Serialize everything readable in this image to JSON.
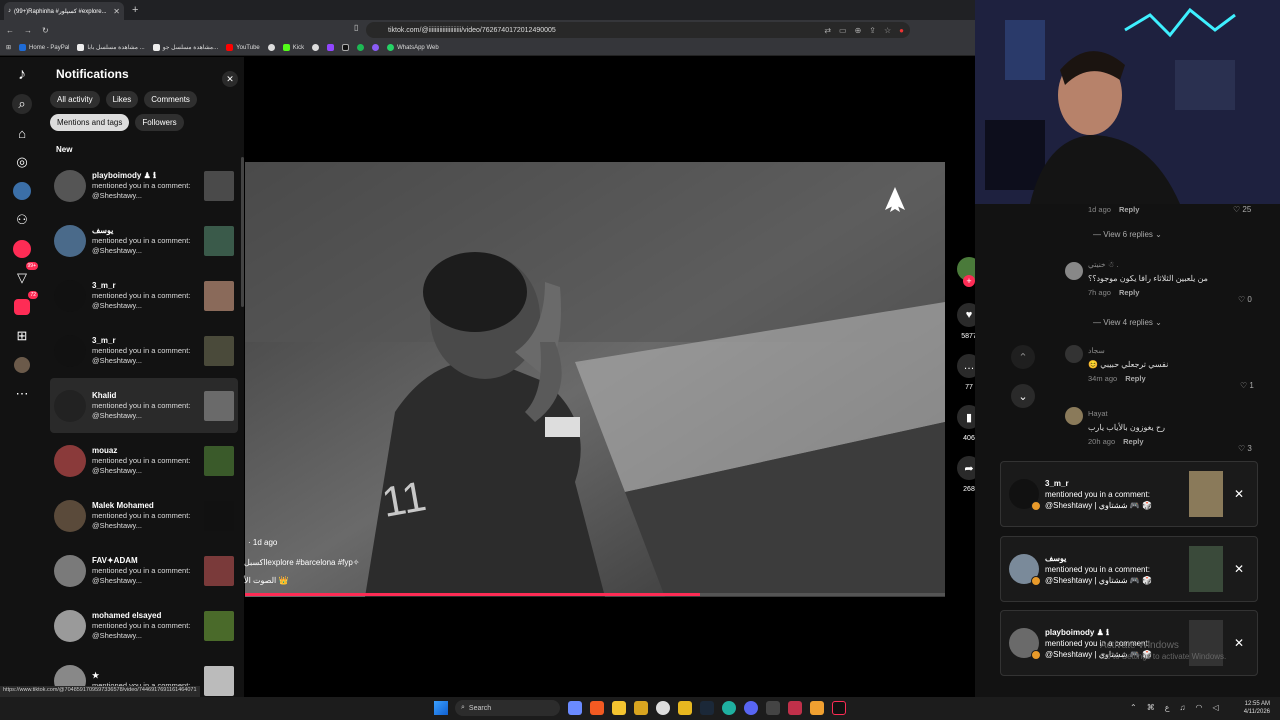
{
  "browser": {
    "tab_title": "(99+)Raphinha #کسپلور #explore...",
    "url": "tiktok.com/@iiiiiiiiiiiiiiiiiiiii/video/7626740172012490005",
    "bookmarks": [
      "Home - PayPal",
      "مشاهدة مسلسل بابا ...",
      "مشاهدة مسلسل جو...",
      "YouTube",
      "",
      "Kick",
      "",
      "",
      "",
      "",
      "WhatsApp Web"
    ]
  },
  "sidebar": {
    "badge_inbox": "99+",
    "badge_activity": "72"
  },
  "notifications": {
    "title": "Notifications",
    "filters": [
      "All activity",
      "Likes",
      "Comments",
      "Mentions and tags",
      "Followers"
    ],
    "selected_filter": "Mentions and tags",
    "section": "New",
    "items": [
      {
        "user": "playboimody ♟ ℹ",
        "text": "mentioned you in a comment: @Sheshtawy..."
      },
      {
        "user": "يوسف",
        "text": "mentioned you in a comment: @Sheshtawy..."
      },
      {
        "user": "3_m_r",
        "text": "mentioned you in a comment: @Sheshtawy..."
      },
      {
        "user": "3_m_r",
        "text": "mentioned you in a comment: @Sheshtawy..."
      },
      {
        "user": "Khalid",
        "text": "mentioned you in a comment: @Sheshtawy..."
      },
      {
        "user": "mouaz",
        "text": "mentioned you in a comment: @Sheshtawy..."
      },
      {
        "user": "Malek Mohamed",
        "text": "mentioned you in a comment: @Sheshtawy..."
      },
      {
        "user": "FAV✦ADAM",
        "text": "mentioned you in a comment: @Sheshtawy..."
      },
      {
        "user": "mohamed elsayed",
        "text": "mentioned you in a comment: @Sheshtawy..."
      },
      {
        "user": "★",
        "text": "mentioned you in a comment:"
      }
    ]
  },
  "video": {
    "time_ago": "· 1d ago",
    "caption": "اكسبلlexplore #barcelona #fyp✧",
    "sound": "الصوت الأ 👑",
    "progress": 0.65,
    "likes": "5877",
    "comments": "77",
    "saves": "406",
    "shares": "268"
  },
  "comments": [
    {
      "text": "",
      "meta": "1d ago",
      "reply": "Reply",
      "likes": "25"
    },
    {
      "view_replies": "View 6 replies"
    },
    {
      "user": "خنيتي ☃ .",
      "text": "من يلعبين الثلاثاء رافا يكون موجود؟؟",
      "meta": "7h ago",
      "reply": "Reply",
      "likes": "0"
    },
    {
      "view_replies": "View 4 replies"
    },
    {
      "user": "سجاد",
      "text": "😊 نفسي ترجعلي حبيبي",
      "meta": "34m ago",
      "reply": "Reply",
      "likes": "1"
    },
    {
      "user": "Hayat",
      "text": "رح يغوزون بالأياب يارب",
      "meta": "20h ago",
      "reply": "Reply",
      "likes": "3"
    }
  ],
  "toasts": [
    {
      "user": "3_m_r",
      "text": "mentioned you in a comment: @Sheshtawy | ششتاوي 🎮 🎲"
    },
    {
      "user": "يوسف",
      "text": "mentioned you in a comment: @Sheshtawy | ششتاوي 🎮 🎲"
    },
    {
      "user": "playboimody ♟ ℹ",
      "text": "mentioned you in a comment: @Sheshtawy | ششتاوي 🎮 🎲"
    }
  ],
  "watermark": {
    "line1": "Activate Windows",
    "line2": "Go to Settings to activate Windows."
  },
  "taskbar": {
    "search": "Search",
    "time": "12:55 AM",
    "date": "4/11/2026"
  },
  "status_url": "https://www.tiktok.com/@7048591709597336578/video/7446917691161464071"
}
